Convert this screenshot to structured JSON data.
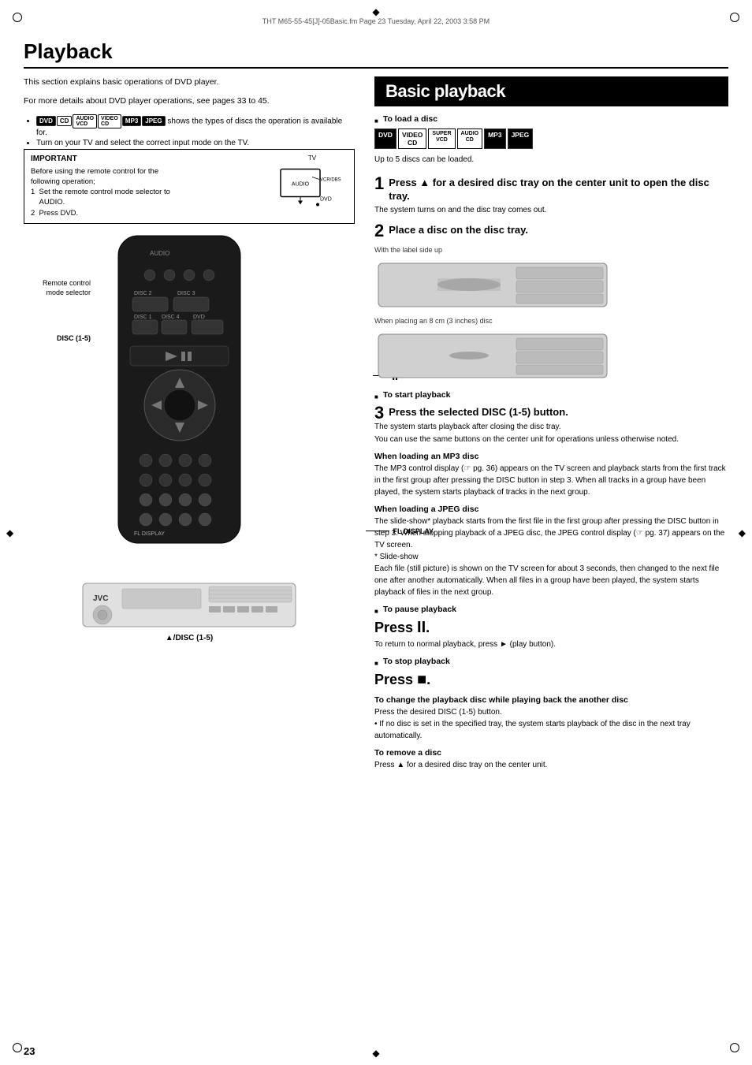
{
  "meta": {
    "file": "THT M65-55-45[J]-05Basic.fm  Page 23  Tuesday, April 22, 2003  3:58 PM"
  },
  "page_number": "23",
  "section_title": "Playback",
  "intro": {
    "line1": "This section explains basic operations of DVD player.",
    "line2": "For more details about DVD player operations, see pages 33 to 45.",
    "bullet1": " shows the types of discs the operation is available for.",
    "bullet2": "Turn on your TV and select the correct input mode on the TV."
  },
  "important": {
    "title": "IMPORTANT",
    "body": "Before using the remote control for the following operation;\n1  Set the remote control mode selector to AUDIO.\n2  Press DVD."
  },
  "remote_labels": {
    "mode_selector": "Remote control\nmode selector",
    "disc_1_5": "DISC (1-5)",
    "dvd": "DVD",
    "play_button": "(play button)",
    "pause": "II",
    "fl_display": "FL DISPLAY"
  },
  "cdplayer_label": "▲/DISC (1-5)",
  "basic_playback": {
    "title": "Basic playback",
    "load_disc": {
      "heading": "To load a disc",
      "note": "Up to 5 discs can be loaded."
    },
    "step1": {
      "num": "1",
      "text": "Press ▲ for a desired disc tray on the center unit to open the disc tray.",
      "sub": "The system turns on and the disc tray comes out."
    },
    "step2": {
      "num": "2",
      "text": "Place a disc on the disc tray.",
      "label_side_up": "With the label side up",
      "label_3inch": "When placing an 8 cm (3 inches) disc"
    },
    "start_playback": {
      "heading": "To start playback"
    },
    "step3": {
      "num": "3",
      "text": "Press the selected DISC (1-5) button.",
      "sub1": "The system starts playback after closing the disc tray.",
      "sub2": "You can use the same buttons on the center unit for operations unless otherwise noted."
    },
    "mp3_heading": "When loading an MP3 disc",
    "mp3_text": "The MP3 control display (☞ pg. 36) appears on the TV screen and playback starts from the first track in the first group after pressing the DISC button in step 3. When all tracks in a group have been played, the system starts playback of tracks in the next group.",
    "jpeg_heading": "When loading a JPEG disc",
    "jpeg_text": "The slide-show* playback starts from the first file in the first group after pressing the DISC button in step 3. When stopping playback of a JPEG disc, the JPEG control display (☞ pg. 37) appears on the TV screen.\n* Slide-show\nEach file (still picture) is shown on the TV screen for about 3 seconds, then changed to the next file one after another automatically. When all files in a group have been played, the system starts playback of files in the next group.",
    "pause_heading": "To pause playback",
    "pause_press": "Press II.",
    "pause_note": "To return to normal playback, press ► (play button).",
    "stop_heading": "To stop playback",
    "stop_press": "Press ■.",
    "change_disc_heading": "To change the playback disc while playing back the another disc",
    "change_disc_text": "Press the desired DISC (1-5) button.\n• If no disc is set in the specified tray, the system starts playback of the disc in the next tray automatically.",
    "remove_disc_heading": "To remove a disc",
    "remove_disc_text": "Press ▲ for a desired disc tray on the center unit."
  }
}
